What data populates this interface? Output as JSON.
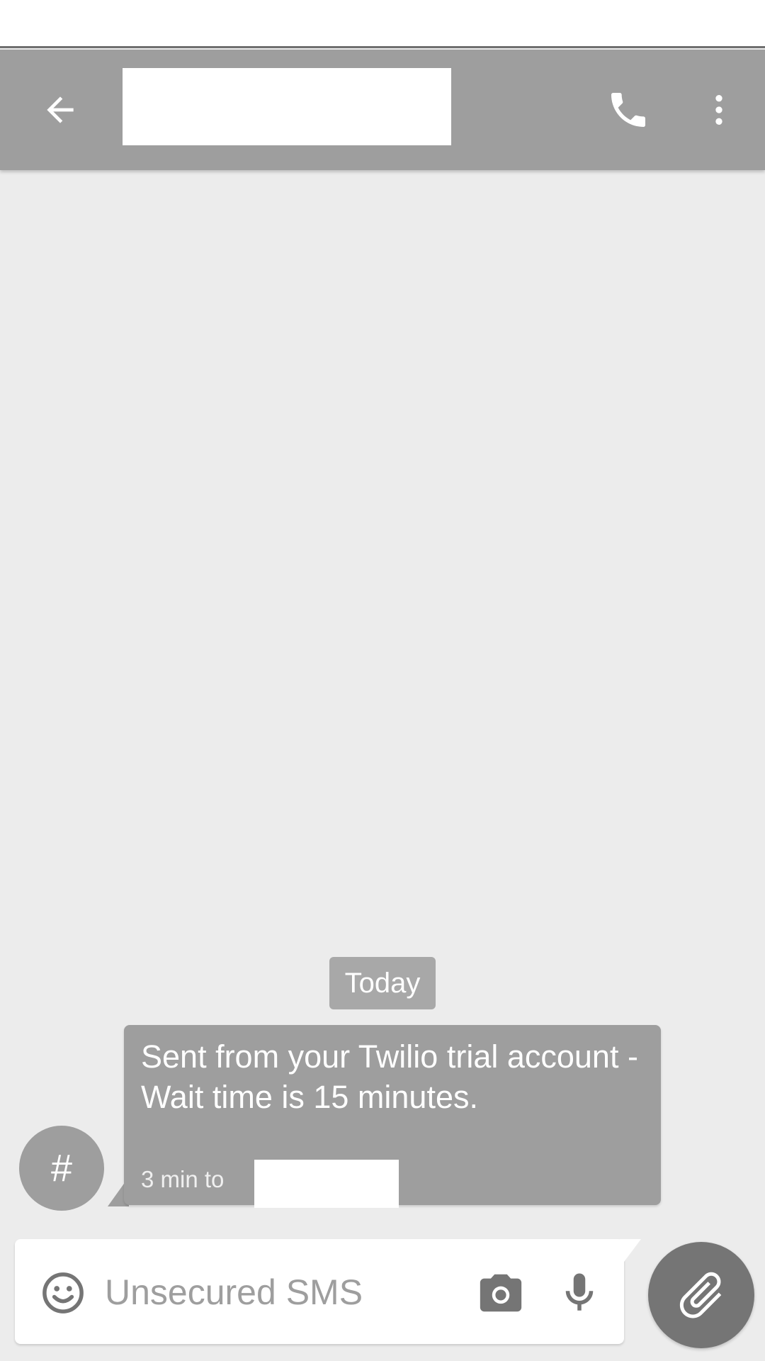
{
  "header": {
    "back_icon": "arrow-back-icon",
    "call_icon": "phone-icon",
    "more_icon": "more-vert-icon"
  },
  "conversation": {
    "date_label": "Today",
    "messages": [
      {
        "avatar_text": "#",
        "text": "Sent from your Twilio trial account - Wait time is 15 minutes.",
        "meta": "3 min to"
      }
    ]
  },
  "composer": {
    "placeholder": "Unsecured SMS",
    "emoji_icon": "emoji-icon",
    "camera_icon": "camera-icon",
    "mic_icon": "mic-icon",
    "attach_icon": "paperclip-icon"
  },
  "colors": {
    "toolbar": "#9e9e9e",
    "background": "#ececec",
    "bubble": "#9e9e9e",
    "fab": "#757575"
  }
}
